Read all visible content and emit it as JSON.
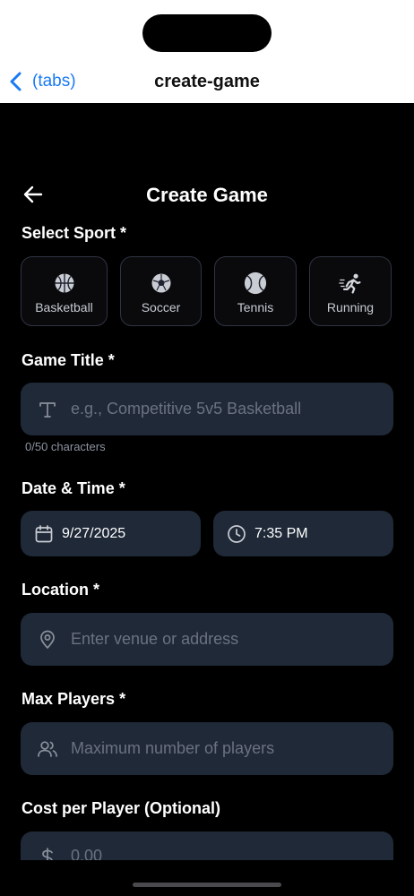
{
  "nav": {
    "back_label": "(tabs)",
    "title": "create-game"
  },
  "screen": {
    "title": "Create Game"
  },
  "sport_section": {
    "label": "Select Sport *",
    "sports": [
      {
        "label": "Basketball",
        "icon": "basketball-icon"
      },
      {
        "label": "Soccer",
        "icon": "soccer-icon"
      },
      {
        "label": "Tennis",
        "icon": "tennis-icon"
      },
      {
        "label": "Running",
        "icon": "running-icon"
      }
    ]
  },
  "title_section": {
    "label": "Game Title *",
    "placeholder": "e.g., Competitive 5v5 Basketball",
    "counter": "0/50 characters"
  },
  "datetime_section": {
    "label": "Date & Time *",
    "date": "9/27/2025",
    "time": "7:35 PM"
  },
  "location_section": {
    "label": "Location *",
    "placeholder": "Enter venue or address"
  },
  "players_section": {
    "label": "Max Players *",
    "placeholder": "Maximum number of players"
  },
  "cost_section": {
    "label": "Cost per Player (Optional)",
    "placeholder": "0.00"
  },
  "colors": {
    "accent": "#1a7bf2",
    "field_bg": "#1f2937",
    "placeholder": "#6b7280"
  }
}
